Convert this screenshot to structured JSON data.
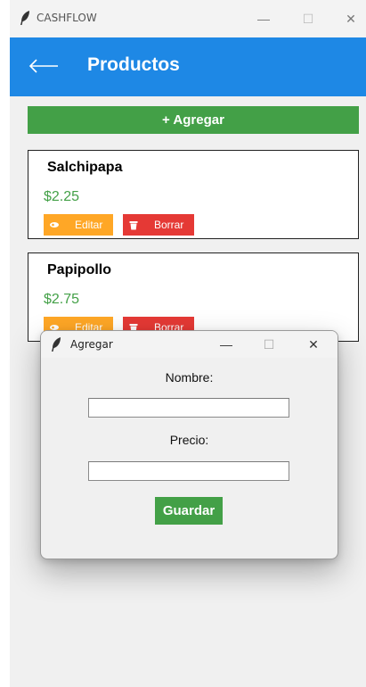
{
  "main_window": {
    "title": "CASHFLOW",
    "controls": {
      "minimize": "—",
      "maximize": "☐",
      "close": "✕"
    }
  },
  "appbar": {
    "back_icon": "arrow-left-icon",
    "title": "Productos"
  },
  "add_button_label": "+ Agregar",
  "products": [
    {
      "name": "Salchipapa",
      "price": "$2.25",
      "edit_label": "Editar",
      "delete_label": "Borrar"
    },
    {
      "name": "Papipollo",
      "price": "$2.75",
      "edit_label": "Editar",
      "delete_label": "Borrar"
    }
  ],
  "dialog": {
    "title": "Agregar",
    "controls": {
      "minimize": "—",
      "maximize": "☐",
      "close": "✕"
    },
    "name_label": "Nombre:",
    "name_value": "",
    "price_label": "Precio:",
    "price_value": "",
    "save_label": "Guardar"
  },
  "colors": {
    "appbar": "#1e88e5",
    "primary_green": "#43a047",
    "edit_orange": "#ffa726",
    "delete_red": "#e53935"
  },
  "icons": {
    "app": "feather-icon",
    "back": "arrow-left-icon",
    "edit": "pencil-icon",
    "delete": "trash-icon"
  }
}
